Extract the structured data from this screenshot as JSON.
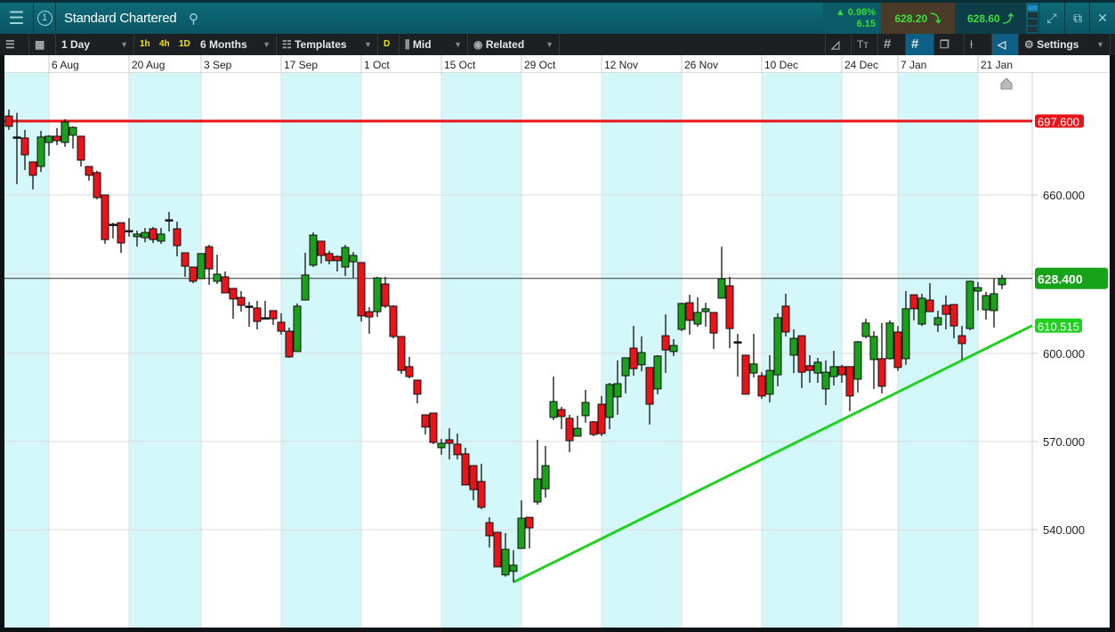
{
  "header": {
    "title": "Standard Chartered",
    "badge": "1",
    "change_pct": "▲ 0.98%",
    "change_abs": "6.15",
    "sell": "628.20",
    "buy": "628.60"
  },
  "toolbar": {
    "interval": "1 Day",
    "q1h": "1h",
    "q4h": "4h",
    "q1d": "1D",
    "range": "6 Months",
    "templates": "Templates",
    "d": "D",
    "price_type": "Mid",
    "related": "Related",
    "settings": "Settings"
  },
  "colors": {
    "up": "#1aa01a",
    "down": "#e8141a",
    "shade": "#d4f7fa",
    "resistance": "#e8141a",
    "trend": "#22d022",
    "current": "#17a317"
  },
  "chart_data": {
    "type": "candlestick",
    "title": "Standard Chartered",
    "x_labels": [
      {
        "bar": 5,
        "label": "6 Aug"
      },
      {
        "bar": 15,
        "label": "20 Aug"
      },
      {
        "bar": 24,
        "label": "3 Sep"
      },
      {
        "bar": 34,
        "label": "17 Sep"
      },
      {
        "bar": 44,
        "label": "1 Oct"
      },
      {
        "bar": 54,
        "label": "15 Oct"
      },
      {
        "bar": 64,
        "label": "29 Oct"
      },
      {
        "bar": 74,
        "label": "12 Nov"
      },
      {
        "bar": 84,
        "label": "26 Nov"
      },
      {
        "bar": 94,
        "label": "10 Dec"
      },
      {
        "bar": 104,
        "label": "24 Dec"
      },
      {
        "bar": 111,
        "label": "7 Jan"
      },
      {
        "bar": 121,
        "label": "21 Jan"
      }
    ],
    "y_ticks": [
      {
        "v": 660,
        "label": "660.000"
      },
      {
        "v": 630,
        "label": ""
      },
      {
        "v": 600,
        "label": "600.000"
      },
      {
        "v": 570,
        "label": "570.000"
      },
      {
        "v": 540,
        "label": "540.000"
      }
    ],
    "levels": [
      {
        "name": "resistance",
        "v": 697.6,
        "label": "697.600"
      },
      {
        "name": "current",
        "v": 628.4,
        "label": "628.400"
      },
      {
        "name": "trend-end",
        "v": 610.515,
        "label": "610.515"
      }
    ],
    "trendline": {
      "start_bar": 63,
      "start_price": 522.1,
      "end_price": 610.515
    },
    "ohlc": [
      [
        699,
        700.8,
        693.1,
        694.9
      ],
      [
        689.5,
        699.9,
        665.5,
        689.5
      ],
      [
        689,
        693.1,
        672.7,
        680.4
      ],
      [
        676.8,
        676.8,
        662.8,
        670
      ],
      [
        674.5,
        692.6,
        671.7,
        689.5
      ],
      [
        686.7,
        690.4,
        679.9,
        689.9
      ],
      [
        689.9,
        694,
        685.4,
        687.6
      ],
      [
        686.7,
        698.1,
        684.5,
        697.1
      ],
      [
        690.4,
        694.9,
        683.6,
        694.4
      ],
      [
        689.9,
        689.9,
        674.5,
        677.7
      ],
      [
        674.5,
        674.5,
        667.3,
        670
      ],
      [
        671.4,
        672.3,
        658.3,
        659
      ],
      [
        660,
        660,
        641.5,
        643.1
      ],
      [
        648.9,
        649.5,
        643.5,
        648.9
      ],
      [
        649.5,
        649.5,
        638.1,
        641.8
      ],
      [
        646.5,
        651.2,
        644.2,
        646.5
      ],
      [
        644.2,
        646.5,
        640.4,
        645.2
      ],
      [
        643.8,
        647.5,
        642.1,
        645.8
      ],
      [
        647.2,
        647.9,
        641.8,
        643.1
      ],
      [
        642.5,
        647.5,
        641.5,
        645.2
      ],
      [
        650.6,
        653.6,
        646.2,
        650.6
      ],
      [
        647.2,
        649.9,
        636.7,
        640.8
      ],
      [
        638.1,
        638.1,
        629,
        633
      ],
      [
        632.7,
        632.7,
        626.6,
        627.3
      ],
      [
        628.3,
        637.8,
        628.3,
        637.8
      ],
      [
        640.4,
        641.1,
        626,
        632
      ],
      [
        627.3,
        637.4,
        626.3,
        630
      ],
      [
        629,
        631,
        622.9,
        622.9
      ],
      [
        624.6,
        624.6,
        613.1,
        620.6
      ],
      [
        621.2,
        623.6,
        615.8,
        618.2
      ],
      [
        617.9,
        619.5,
        610.1,
        617.9
      ],
      [
        617.2,
        619.9,
        609.1,
        612.1
      ],
      [
        613.5,
        619.9,
        613.5,
        613.5
      ],
      [
        616.2,
        616.2,
        610.8,
        613.1
      ],
      [
        611.8,
        615.2,
        607.1,
        608.4
      ],
      [
        608.4,
        609.8,
        598.5,
        598.8
      ],
      [
        600.7,
        618.9,
        600.7,
        617.9
      ],
      [
        620.2,
        638.1,
        620.2,
        629.7
      ],
      [
        633.4,
        645.8,
        632.7,
        644.8
      ],
      [
        642.5,
        642.5,
        634,
        637.1
      ],
      [
        637.8,
        638.8,
        633.7,
        635.1
      ],
      [
        636.7,
        637.1,
        631,
        635.1
      ],
      [
        632.7,
        641.1,
        629.3,
        640.1
      ],
      [
        634.7,
        638.4,
        628.6,
        637.1
      ],
      [
        634.4,
        634.4,
        612.1,
        614.2
      ],
      [
        615.8,
        617.5,
        607.4,
        613.8
      ],
      [
        615.8,
        629,
        613.8,
        628.6
      ],
      [
        626.3,
        629,
        617.2,
        617.9
      ],
      [
        617.9,
        618.2,
        605.7,
        606.4
      ],
      [
        606.4,
        606.4,
        593,
        594.2
      ],
      [
        595.5,
        598.8,
        591.5,
        592.1
      ],
      [
        590.9,
        590.9,
        583,
        586.1
      ],
      [
        579.1,
        579.1,
        572.4,
        574.9
      ],
      [
        579.7,
        579.7,
        569.1,
        569.7
      ],
      [
        567.9,
        570.9,
        565.5,
        569.4
      ],
      [
        570.6,
        574.5,
        563.9,
        569.4
      ],
      [
        569.1,
        572.7,
        563.9,
        565.5
      ],
      [
        565.8,
        567.9,
        555.2,
        555.2
      ],
      [
        561.8,
        561.8,
        550,
        553.6
      ],
      [
        556.4,
        562.4,
        547,
        547.6
      ],
      [
        542.4,
        544.2,
        533.9,
        537.9
      ],
      [
        539.1,
        539.1,
        527.3,
        527.3
      ],
      [
        524.6,
        538.8,
        524,
        533.3
      ],
      [
        525.8,
        533,
        522.1,
        527.9
      ],
      [
        533.6,
        550,
        533.6,
        543.9
      ],
      [
        544.2,
        544.2,
        533.6,
        540.6
      ],
      [
        549.4,
        570.6,
        548.5,
        557.3
      ],
      [
        553.9,
        568.5,
        550.9,
        561.8
      ],
      [
        578.2,
        592.1,
        577.3,
        583.6
      ],
      [
        580.9,
        581.8,
        574.2,
        578.5
      ],
      [
        577.9,
        579.1,
        566.4,
        570.3
      ],
      [
        571.8,
        578.8,
        571.8,
        574.5
      ],
      [
        578.8,
        587.6,
        576.4,
        583.3
      ],
      [
        576.7,
        577,
        571.8,
        572.4
      ],
      [
        582.7,
        585.5,
        571.8,
        572.7
      ],
      [
        578.2,
        590,
        574.2,
        589.4
      ],
      [
        585.2,
        597.6,
        579.1,
        589.7
      ],
      [
        592.4,
        598.5,
        586.4,
        598.5
      ],
      [
        602,
        610.4,
        592.4,
        594.8
      ],
      [
        596.1,
        606.4,
        593.9,
        600.3
      ],
      [
        595.2,
        595.2,
        575.8,
        582.7
      ],
      [
        587.9,
        599.4,
        586.1,
        599.1
      ],
      [
        606.7,
        614.8,
        593.3,
        601.3
      ],
      [
        600.7,
        605.4,
        599.1,
        603
      ],
      [
        609.1,
        619.2,
        608.4,
        618.9
      ],
      [
        619.2,
        622.2,
        607.1,
        612.5
      ],
      [
        611.1,
        621.2,
        610.1,
        615.5
      ],
      [
        615.8,
        619.2,
        610.1,
        616.9
      ],
      [
        615.5,
        615.5,
        601.7,
        607.7
      ],
      [
        620.9,
        640.4,
        620.9,
        628.3
      ],
      [
        625.6,
        629,
        602,
        609.4
      ],
      [
        604.4,
        607.4,
        592.1,
        604.4
      ],
      [
        599.4,
        599.4,
        586.1,
        586.1
      ],
      [
        593.3,
        607.4,
        591.8,
        596.4
      ],
      [
        592.4,
        593.6,
        584.5,
        585.5
      ],
      [
        586.1,
        599.4,
        583.3,
        594.2
      ],
      [
        592.7,
        615.2,
        588.8,
        613.5
      ],
      [
        617.9,
        622.6,
        606.4,
        608.1
      ],
      [
        599.4,
        609.1,
        593.3,
        605.7
      ],
      [
        606.7,
        606.7,
        588.2,
        593.6
      ],
      [
        595.8,
        599.4,
        590,
        594.2
      ],
      [
        593.3,
        598.5,
        590,
        597
      ],
      [
        587.9,
        597.6,
        582.4,
        593.6
      ],
      [
        592.1,
        601,
        589.1,
        595.5
      ],
      [
        595.5,
        596.1,
        590,
        592.7
      ],
      [
        595.5,
        595.5,
        580.3,
        585.5
      ],
      [
        591.2,
        604.7,
        586.7,
        604.4
      ],
      [
        606.4,
        613.1,
        605.7,
        611.5
      ],
      [
        597.9,
        608.4,
        587.9,
        606.4
      ],
      [
        598.2,
        611.5,
        586.4,
        588.8
      ],
      [
        598.2,
        612.5,
        597.9,
        611.5
      ],
      [
        608.1,
        610.4,
        594,
        595.2
      ],
      [
        598.2,
        623.6,
        596.1,
        616.9
      ],
      [
        622.2,
        622.2,
        612.5,
        616.9
      ],
      [
        611.1,
        622.6,
        610.4,
        620.9
      ],
      [
        620.2,
        626.6,
        615.8,
        615.8
      ],
      [
        610.8,
        616.2,
        608.1,
        613.5
      ],
      [
        618.2,
        621.9,
        609.1,
        614.8
      ],
      [
        618.5,
        618.5,
        605.7,
        610.4
      ],
      [
        606.7,
        610.4,
        597.9,
        603.7
      ],
      [
        609.4,
        627.6,
        608.8,
        627.3
      ],
      [
        623.6,
        627,
        616.2,
        624.9
      ],
      [
        616.5,
        623.3,
        612.8,
        621.9
      ],
      [
        616.2,
        628.3,
        609.8,
        622.6
      ],
      [
        626,
        629.7,
        624.3,
        628.4
      ]
    ]
  }
}
